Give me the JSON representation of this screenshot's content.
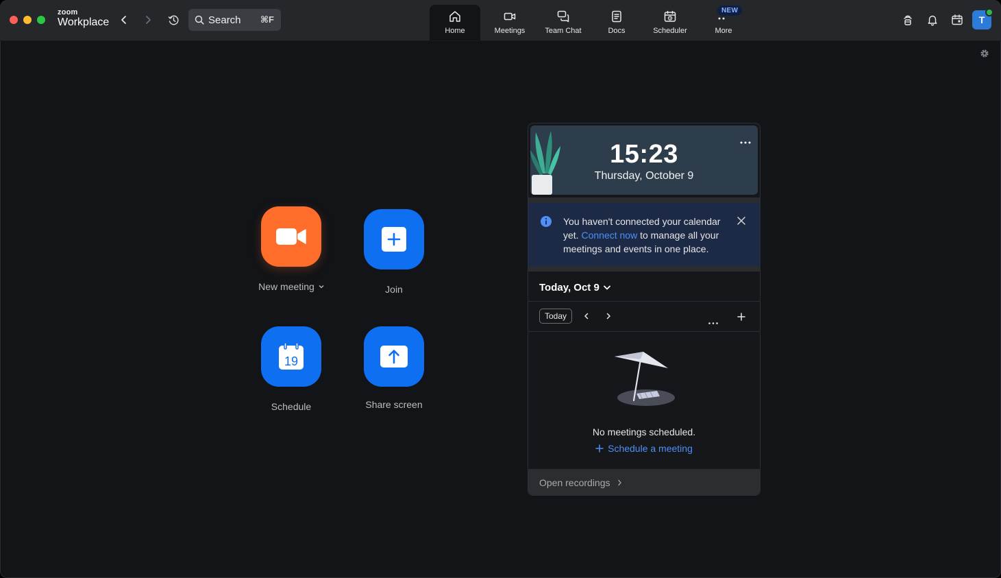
{
  "app": {
    "brand_small": "zoom",
    "brand_large": "Workplace",
    "accent": "#0e6ff0",
    "orange": "#ff6d2a"
  },
  "titlebar": {
    "search_label": "Search",
    "search_shortcut": "⌘F",
    "tabs": [
      {
        "label": "Home",
        "icon": "home-icon",
        "active": true
      },
      {
        "label": "Meetings",
        "icon": "video-icon"
      },
      {
        "label": "Team Chat",
        "icon": "chat-icon"
      },
      {
        "label": "Docs",
        "icon": "docs-icon"
      },
      {
        "label": "Scheduler",
        "icon": "scheduler-icon"
      },
      {
        "label": "More",
        "icon": "more-icon",
        "badge": "NEW"
      }
    ],
    "avatar_initial": "T"
  },
  "actions": [
    {
      "label": "New meeting",
      "icon": "video-camera-icon"
    },
    {
      "label": "Join",
      "icon": "plus-icon"
    },
    {
      "label": "Schedule",
      "icon": "calendar-icon",
      "day": "19"
    },
    {
      "label": "Share screen",
      "icon": "share-up-arrow-icon"
    }
  ],
  "calendar": {
    "time": "15:23",
    "date": "Thursday, October 9",
    "notice_before": "You haven't connected your calendar yet. ",
    "notice_link": "Connect now",
    "notice_after": " to manage all your meetings and events in one place.",
    "day_heading": "Today, Oct 9",
    "today_button": "Today",
    "empty_text": "No meetings scheduled.",
    "schedule_link": "Schedule a meeting",
    "footer_link": "Open recordings"
  }
}
